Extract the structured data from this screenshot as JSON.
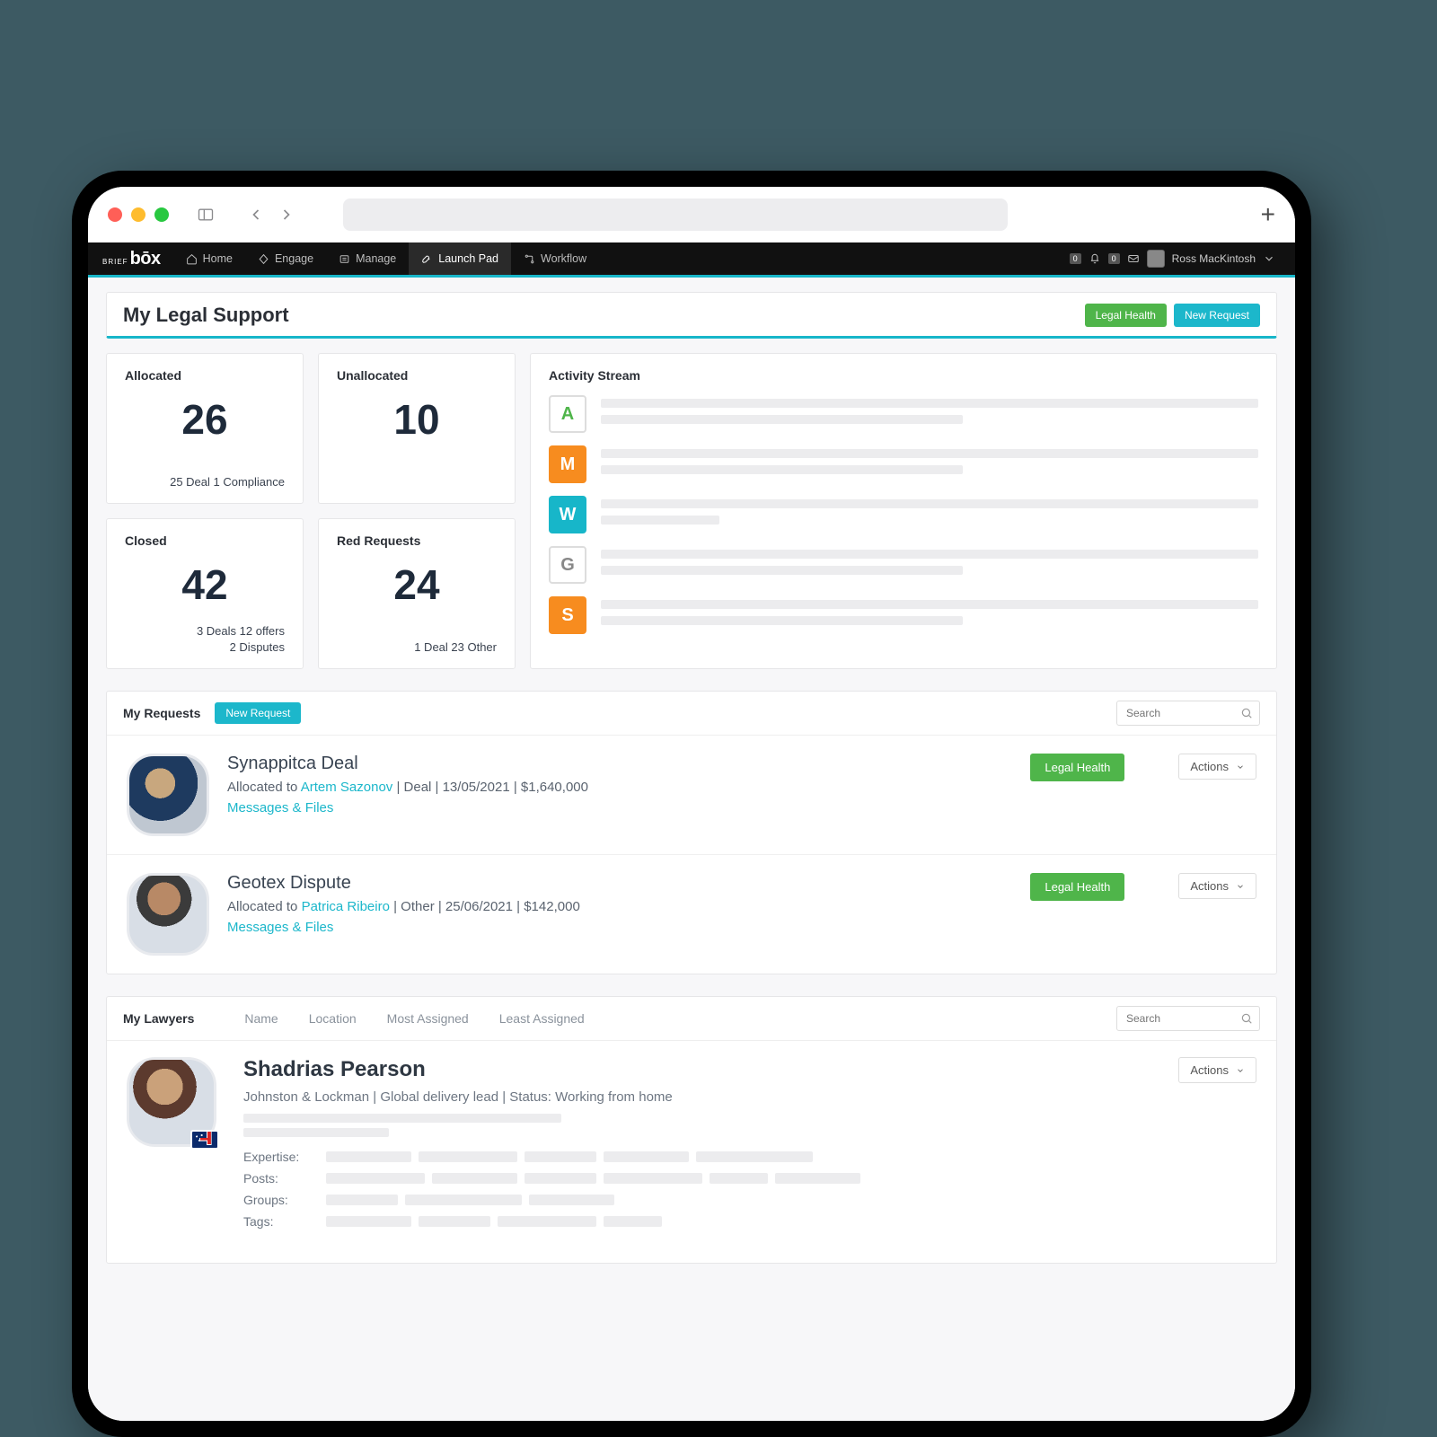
{
  "nav": {
    "logo_small": "BRIEF",
    "logo_main": "bōx",
    "items": [
      {
        "label": "Home"
      },
      {
        "label": "Engage"
      },
      {
        "label": "Manage"
      },
      {
        "label": "Launch Pad"
      },
      {
        "label": "Workflow"
      }
    ],
    "counts": {
      "a": "0",
      "b": "0"
    },
    "user": "Ross MacKintosh"
  },
  "page": {
    "title": "My Legal Support",
    "legal_health": "Legal Health",
    "new_request": "New Request"
  },
  "stats": {
    "allocated": {
      "title": "Allocated",
      "value": "26",
      "foot1": "25 Deal   1 Compliance",
      "foot2": ""
    },
    "unallocated": {
      "title": "Unallocated",
      "value": "10",
      "foot1": "",
      "foot2": ""
    },
    "closed": {
      "title": "Closed",
      "value": "42",
      "foot1": "3 Deals   12 offers",
      "foot2": "2 Disputes"
    },
    "red": {
      "title": "Red Requests",
      "value": "24",
      "foot1": "1 Deal   23 Other",
      "foot2": ""
    }
  },
  "activity": {
    "title": "Activity Stream",
    "items": [
      {
        "letter": "A",
        "style": "outline green"
      },
      {
        "letter": "M",
        "style": "orange"
      },
      {
        "letter": "W",
        "style": "teal"
      },
      {
        "letter": "G",
        "style": "outline gray"
      },
      {
        "letter": "S",
        "style": "orange"
      }
    ]
  },
  "requests": {
    "title": "My Requests",
    "new_button": "New Request",
    "search_placeholder": "Search",
    "actions_label": "Actions",
    "legal_health_label": "Legal Health",
    "messages_label": "Messages & Files",
    "items": [
      {
        "title": "Synappitca Deal",
        "prefix": "Allocated to ",
        "person": "Artem Sazonov",
        "meta": " | Deal | 13/05/2021 | $1,640,000"
      },
      {
        "title": "Geotex Dispute",
        "prefix": "Allocated to ",
        "person": "Patrica Ribeiro",
        "meta": " | Other | 25/06/2021 | $142,000"
      }
    ]
  },
  "lawyers": {
    "title": "My Lawyers",
    "sorts": [
      "Name",
      "Location",
      "Most Assigned",
      "Least Assigned"
    ],
    "search_placeholder": "Search",
    "actions_label": "Actions",
    "item": {
      "name": "Shadrias Pearson",
      "meta": "Johnston & Lockman  |  Global delivery lead  |  Status: Working from home",
      "labels": {
        "expertise": "Expertise:",
        "posts": "Posts:",
        "groups": "Groups:",
        "tags": "Tags:"
      }
    }
  }
}
